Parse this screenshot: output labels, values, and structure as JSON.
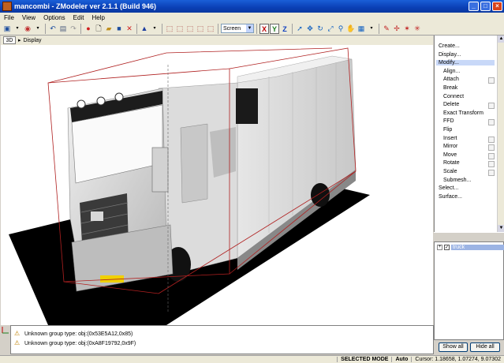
{
  "window": {
    "title": "mancombi - ZModeler ver 2.1.1 (Build 946)"
  },
  "menu": [
    "File",
    "View",
    "Options",
    "Edit",
    "Help"
  ],
  "toolbar": {
    "coord_mode": "Screen",
    "axes": [
      {
        "label": "X",
        "color": "#c00000",
        "active": true
      },
      {
        "label": "Y",
        "color": "#208020",
        "active": true
      },
      {
        "label": "Z",
        "color": "#1040c0",
        "active": false
      }
    ]
  },
  "viewport": {
    "mode_label": "3D",
    "menu_label": "Display"
  },
  "command_panel": {
    "items": [
      {
        "label": "Create...",
        "indent": false,
        "checkbox": false,
        "highlighted": false
      },
      {
        "label": "Display...",
        "indent": false,
        "checkbox": false,
        "highlighted": false
      },
      {
        "label": "Modify...",
        "indent": false,
        "checkbox": false,
        "highlighted": true
      },
      {
        "label": "Align...",
        "indent": true,
        "checkbox": false,
        "highlighted": false
      },
      {
        "label": "Attach",
        "indent": true,
        "checkbox": true,
        "highlighted": false
      },
      {
        "label": "Break",
        "indent": true,
        "checkbox": false,
        "highlighted": false
      },
      {
        "label": "Connect",
        "indent": true,
        "checkbox": false,
        "highlighted": false
      },
      {
        "label": "Delete",
        "indent": true,
        "checkbox": true,
        "highlighted": false
      },
      {
        "label": "Exact Transform",
        "indent": true,
        "checkbox": false,
        "highlighted": false
      },
      {
        "label": "FFD",
        "indent": true,
        "checkbox": true,
        "highlighted": false
      },
      {
        "label": "Flip",
        "indent": true,
        "checkbox": false,
        "highlighted": false
      },
      {
        "label": "Insert",
        "indent": true,
        "checkbox": true,
        "highlighted": false
      },
      {
        "label": "Mirror",
        "indent": true,
        "checkbox": true,
        "highlighted": false
      },
      {
        "label": "Move",
        "indent": true,
        "checkbox": true,
        "highlighted": false
      },
      {
        "label": "Rotate",
        "indent": true,
        "checkbox": true,
        "highlighted": false
      },
      {
        "label": "Scale",
        "indent": true,
        "checkbox": true,
        "highlighted": false
      },
      {
        "label": "Submesh...",
        "indent": true,
        "checkbox": false,
        "highlighted": false
      },
      {
        "label": "Select...",
        "indent": false,
        "checkbox": false,
        "highlighted": false
      },
      {
        "label": "Surface...",
        "indent": false,
        "checkbox": false,
        "highlighted": false
      }
    ]
  },
  "object_tree": {
    "items": [
      {
        "label": "truck",
        "checked": true
      }
    ]
  },
  "tree_buttons": {
    "show_all": "Show all",
    "hide_all": "Hide all"
  },
  "log": {
    "messages": [
      "Unknown group type: obj:(0x53E5A12,0x85)",
      "Unknown group type: obj:(0xA8F19792,0x9F)"
    ]
  },
  "status": {
    "mode": "SELECTED MODE",
    "auto": "Auto",
    "cursor": "Cursor: 1.18658, 1.07274, 9.07302"
  }
}
